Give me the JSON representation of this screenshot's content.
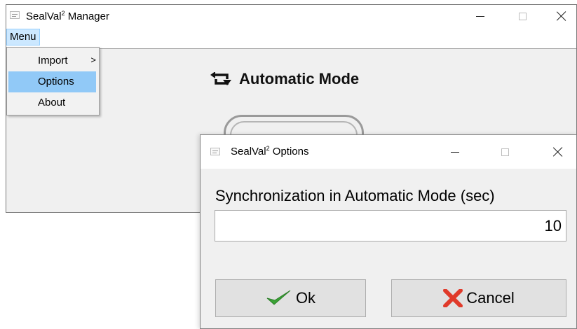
{
  "main_window": {
    "title": "SealVal",
    "title_sup": "2",
    "title_suffix": " Manager",
    "menu_label": "Menu"
  },
  "dropdown": {
    "items": [
      {
        "label": "Import",
        "has_submenu": true,
        "submenu_glyph": ">"
      },
      {
        "label": "Options",
        "selected": true
      },
      {
        "label": "About"
      }
    ]
  },
  "main_content": {
    "mode_label": "Automatic Mode",
    "mode_icon": "repeat-arrows-icon"
  },
  "options_dialog": {
    "title": "SealVal",
    "title_sup": "2",
    "title_suffix": " Options",
    "sync_label": "Synchronization in Automatic Mode (sec)",
    "sync_value": "10",
    "ok_label": "Ok",
    "cancel_label": "Cancel",
    "ok_icon": "checkmark-icon",
    "cancel_icon": "red-x-icon"
  },
  "colors": {
    "selected_menu_bg": "#91c9f7",
    "menu_highlight": "#cce8ff",
    "check_green": "#3aa335",
    "cancel_red": "#e03a2a"
  }
}
